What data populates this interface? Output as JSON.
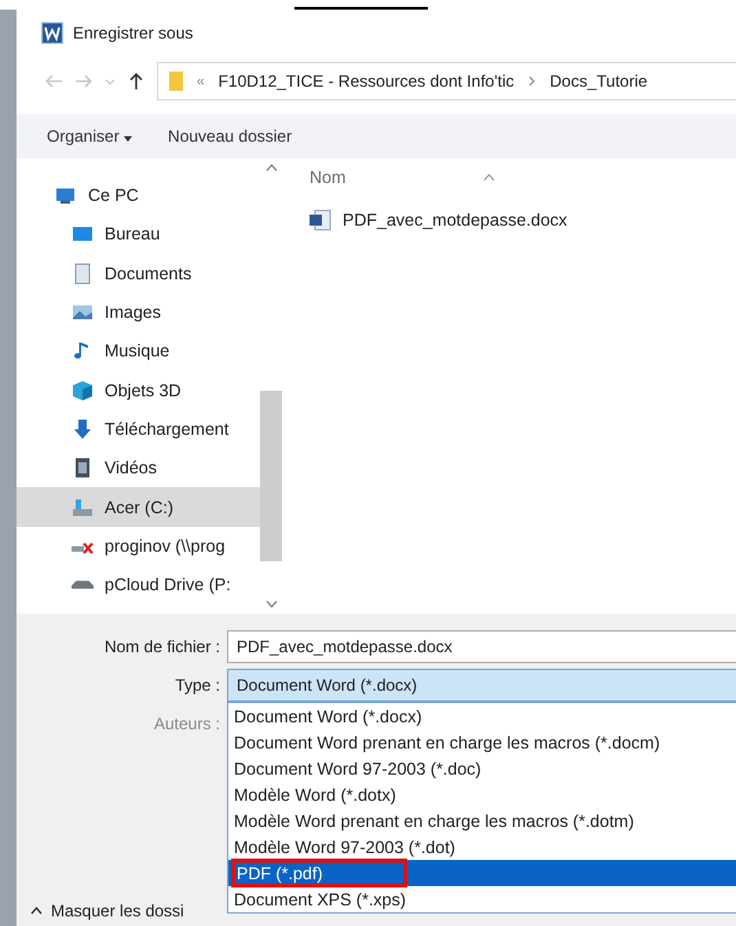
{
  "window": {
    "title": "Enregistrer sous"
  },
  "address_bar": {
    "overflow": "«",
    "segments": [
      "F10D12_TICE - Ressources dont Info'tic",
      "Docs_Tutorie"
    ]
  },
  "toolbar": {
    "organise": "Organiser",
    "new_folder": "Nouveau dossier"
  },
  "sidebar": {
    "items": [
      {
        "label": "Ce PC",
        "kind": "pc",
        "selected": false,
        "children": [
          {
            "label": "Bureau",
            "kind": "desktop",
            "selected": false
          },
          {
            "label": "Documents",
            "kind": "documents",
            "selected": false
          },
          {
            "label": "Images",
            "kind": "images",
            "selected": false
          },
          {
            "label": "Musique",
            "kind": "music",
            "selected": false
          },
          {
            "label": "Objets 3D",
            "kind": "objects",
            "selected": false
          },
          {
            "label": "Téléchargement",
            "kind": "download",
            "selected": false
          },
          {
            "label": "Vidéos",
            "kind": "videos",
            "selected": false
          },
          {
            "label": "Acer (C:)",
            "kind": "drive",
            "selected": true
          },
          {
            "label": "proginov (\\\\prog",
            "kind": "netdrive",
            "selected": false
          },
          {
            "label": "pCloud Drive (P:",
            "kind": "cloud",
            "selected": false
          }
        ]
      }
    ]
  },
  "file_list": {
    "columns": [
      "Nom"
    ],
    "files": [
      "PDF_avec_motdepasse.docx"
    ]
  },
  "form": {
    "filename_label": "Nom de fichier :",
    "filename": "PDF_avec_motdepasse.docx",
    "type_label": "Type :",
    "type_value": "Document Word (*.docx)",
    "authors_label": "Auteurs :",
    "hide_folders": "Masquer les dossi"
  },
  "type_options": [
    {
      "label": "Document Word (*.docx)",
      "selected": false,
      "highlighted": false
    },
    {
      "label": "Document Word prenant en charge les macros (*.docm)",
      "selected": false,
      "highlighted": false
    },
    {
      "label": "Document Word 97-2003 (*.doc)",
      "selected": false,
      "highlighted": false
    },
    {
      "label": "Modèle Word (*.dotx)",
      "selected": false,
      "highlighted": false
    },
    {
      "label": "Modèle Word prenant en charge les macros (*.dotm)",
      "selected": false,
      "highlighted": false
    },
    {
      "label": "Modèle Word 97-2003 (*.dot)",
      "selected": false,
      "highlighted": false
    },
    {
      "label": "PDF (*.pdf)",
      "selected": true,
      "highlighted": true
    },
    {
      "label": "Document XPS (*.xps)",
      "selected": false,
      "highlighted": false
    }
  ]
}
